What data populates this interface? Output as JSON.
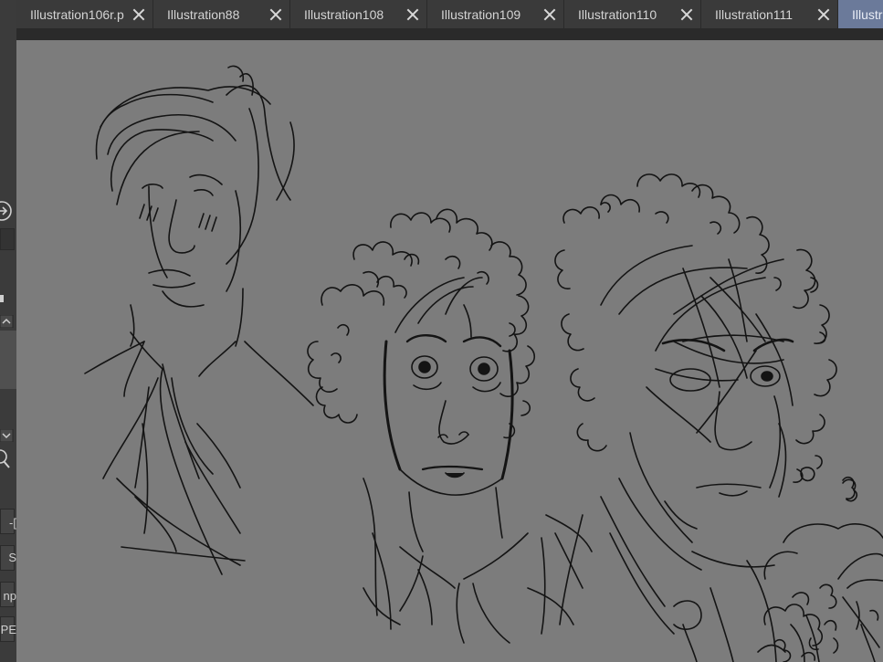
{
  "tabs": [
    {
      "label": "Illustration106r.p",
      "active": false
    },
    {
      "label": "Illustration88",
      "active": false
    },
    {
      "label": "Illustration108",
      "active": false
    },
    {
      "label": "Illustration109",
      "active": false
    },
    {
      "label": "Illustration110",
      "active": false
    },
    {
      "label": "Illustration111",
      "active": false
    },
    {
      "label": "Illustra",
      "active": true
    }
  ],
  "left_toolbar": {
    "fragments": [
      "-[",
      "S",
      "np",
      "PE"
    ]
  },
  "colors": {
    "canvas": "#7c7c7c",
    "tab_bg": "#3a3a3a",
    "tab_active": "#6b7a9a",
    "ink": "#141414"
  }
}
